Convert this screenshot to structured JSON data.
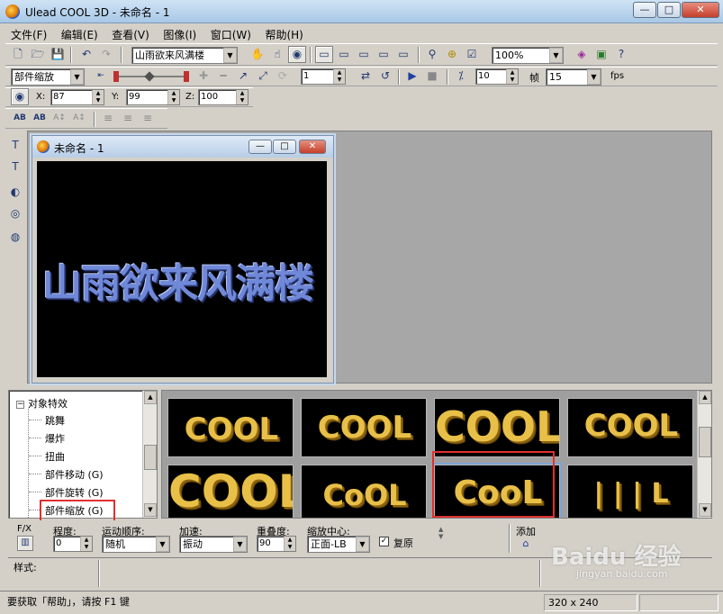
{
  "window": {
    "title": "Ulead COOL 3D - 未命名 - 1",
    "controls": [
      "—",
      "□",
      "✕"
    ]
  },
  "menu": [
    "文件(F)",
    "编辑(E)",
    "查看(V)",
    "图像(I)",
    "窗口(W)",
    "帮助(H)"
  ],
  "toolbar1": {
    "text_combo": "山雨欲来风满楼",
    "zoom_combo": "100%"
  },
  "toolbar2": {
    "effect_combo": "部件缩放",
    "frame_value": "1",
    "speed_value": "10",
    "frames_label": "帧",
    "frames_value": "15",
    "fps_label": "fps"
  },
  "toolbar3": {
    "x_label": "X:",
    "x_value": "87",
    "y_label": "Y:",
    "y_value": "99",
    "z_label": "Z:",
    "z_value": "100"
  },
  "document": {
    "title": "未命名 - 1",
    "canvas_text": "山雨欲来风满楼"
  },
  "tree": {
    "root": "对象特效",
    "items": [
      "跳舞",
      "爆炸",
      "扭曲",
      "部件移动 (G)",
      "部件旋转 (G)",
      "部件缩放 (G)"
    ],
    "highlighted_index": 5
  },
  "thumbnails": [
    "COOL",
    "COOL",
    "COOL",
    "COOL",
    "COOL",
    "CoOL",
    "CooL",
    "| | | L"
  ],
  "properties": {
    "fx_label": "F/X",
    "degree_label": "程度:",
    "degree_value": "0",
    "order_label": "运动顺序:",
    "order_value": "随机",
    "accel_label": "加速:",
    "accel_value": "振动",
    "overlap_label": "重叠度:",
    "overlap_value": "90",
    "center_label": "缩放中心:",
    "center_value": "正面-LB",
    "restore_label": "复原",
    "add_label": "添加"
  },
  "style_label": "样式:",
  "status": {
    "help_text": "要获取「帮助」，请按 F1 键",
    "size_text": "320 x 240"
  },
  "watermark": {
    "brand": "Baidu 经验",
    "url": "jingyan.baidu.com"
  },
  "colors": {
    "canvas_text": "#6f88d8",
    "thumb_text": "#e8c048",
    "highlight": "#e03030"
  }
}
